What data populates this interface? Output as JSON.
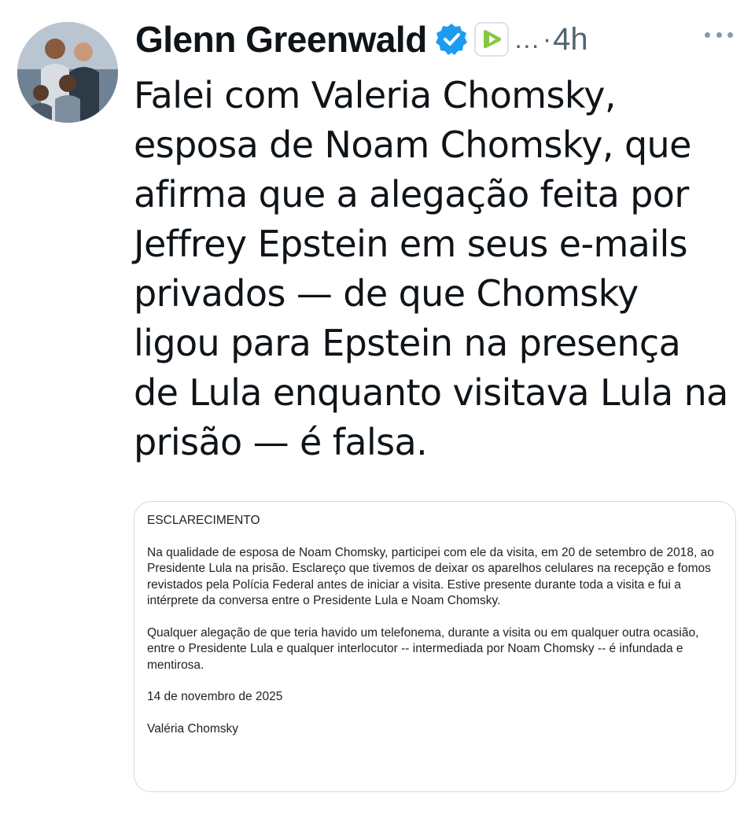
{
  "tweet": {
    "author": {
      "name": "Glenn Greenwald",
      "avatar_icon": "profile-photo-icon",
      "verified_icon": "verified-badge-icon",
      "affiliate_icon": "rumble-play-icon"
    },
    "ellipsis": "…",
    "separator": "·",
    "time": "4h",
    "more_icon": "more-options-icon",
    "text": "Falei com Valeria Chomsky,\nesposa de Noam Chomsky, que\nafirma que a alegação feita por\nJeffrey Epstein em seus e-mails\nprivados — de que Chomsky\nligou para Epstein na presença\nde Lula enquanto visitava Lula na\nprisão — é falsa."
  },
  "media": {
    "heading": "ESCLARECIMENTO",
    "paragraph_1": "Na qualidade de esposa de Noam Chomsky, participei com ele da visita, em 20 de setembro de 2018,  ao Presidente Lula na prisão. Esclareço que tivemos de deixar os aparelhos celulares na recepção e fomos revistados pela Polícia Federal antes de iniciar a visita. Estive presente durante toda a visita e fui a intérprete da conversa entre o Presidente Lula e Noam Chomsky.",
    "paragraph_2": "Qualquer alegação de que teria havido um telefonema, durante a visita ou em qualquer outra ocasião, entre o Presidente Lula e qualquer interlocutor -- intermediada por Noam Chomsky -- é infundada e mentirosa.",
    "date": "14 de novembro de 2025",
    "signature": "Valéria Chomsky"
  },
  "colors": {
    "text_primary": "#0f1419",
    "text_secondary": "#536471",
    "verified_blue": "#1d9bf0",
    "rumble_green": "#85c742",
    "card_border": "#d3d9de"
  }
}
